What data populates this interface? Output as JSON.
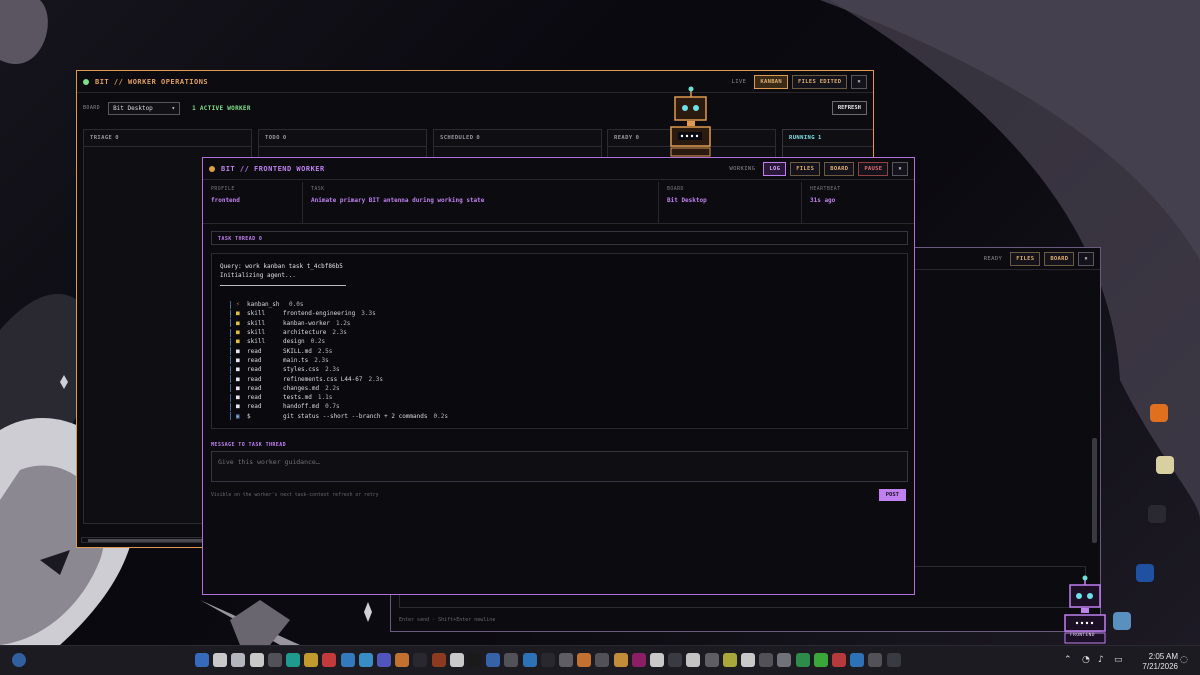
{
  "colors": {
    "accent_orange": "#e09a50",
    "accent_purple": "#c080f0",
    "active_green": "#7ee08a"
  },
  "ops": {
    "title": "BIT // WORKER OPERATIONS",
    "status": "LIVE",
    "btn_kanban": "KANBAN",
    "btn_files_edited": "FILES EDITED",
    "btn_close": "×",
    "board_label": "BOARD",
    "board_value": "Bit Desktop",
    "active_workers": "1 ACTIVE WORKER",
    "btn_refresh": "REFRESH",
    "columns": [
      {
        "name": "TRIAGE",
        "count": "0"
      },
      {
        "name": "TODO",
        "count": "0"
      },
      {
        "name": "SCHEDULED",
        "count": "0"
      },
      {
        "name": "READY",
        "count": "0"
      },
      {
        "name": "RUNNING",
        "count": "1"
      }
    ]
  },
  "back": {
    "status": "READY",
    "btn_files": "FILES",
    "btn_board": "BOARD",
    "btn_close": "×",
    "footer_hint": "Enter send · Shift+Enter newline",
    "robot_label": "FRONTEND"
  },
  "worker": {
    "title": "BIT // FRONTEND WORKER",
    "status": "WORKING",
    "btn_log": "LOG",
    "btn_files": "FILES",
    "btn_board": "BOARD",
    "btn_pause": "PAUSE",
    "btn_close": "×",
    "profile_label": "PROFILE",
    "profile_value": "frontend",
    "task_label": "TASK",
    "task_value": "Animate primary BIT antenna during working state",
    "board_label": "BOARD",
    "board_value": "Bit Desktop",
    "heartbeat_label": "HEARTBEAT",
    "heartbeat_value": "31s ago",
    "thread_label": "TASK THREAD 0",
    "query_line": "Query: work kanban task t_4cbf86b5",
    "init_line": "Initializing agent...",
    "log_rows": [
      {
        "icon": "⚡",
        "kind": "kanban_sh",
        "value": "",
        "time": "0.0s"
      },
      {
        "icon": "■",
        "kind": "skill",
        "value": "frontend-engineering",
        "time": "3.3s"
      },
      {
        "icon": "■",
        "kind": "skill",
        "value": "kanban-worker",
        "time": "1.2s"
      },
      {
        "icon": "■",
        "kind": "skill",
        "value": "architecture",
        "time": "2.3s"
      },
      {
        "icon": "■",
        "kind": "skill",
        "value": "design",
        "time": "0.2s"
      },
      {
        "icon": "■",
        "kind": "read",
        "value": "SKILL.md",
        "time": "2.5s"
      },
      {
        "icon": "■",
        "kind": "read",
        "value": "main.ts",
        "time": "2.3s"
      },
      {
        "icon": "■",
        "kind": "read",
        "value": "styles.css",
        "time": "2.3s"
      },
      {
        "icon": "■",
        "kind": "read",
        "value": "refinements.css L44-67",
        "time": "2.3s"
      },
      {
        "icon": "■",
        "kind": "read",
        "value": "changes.md",
        "time": "2.2s"
      },
      {
        "icon": "■",
        "kind": "read",
        "value": "tests.md",
        "time": "1.1s"
      },
      {
        "icon": "■",
        "kind": "read",
        "value": "handoff.md",
        "time": "0.7s"
      },
      {
        "icon": "▣",
        "kind": "$",
        "value": "git status --short --branch + 2 commands",
        "time": "0.2s"
      }
    ],
    "message_label": "MESSAGE TO TASK THREAD",
    "message_placeholder": "Give this worker guidance…",
    "note": "Visible on the worker's next task-context refresh or retry",
    "btn_post": "POST"
  },
  "taskbar": {
    "time": "2:05 AM",
    "date": "7/21/2026"
  }
}
